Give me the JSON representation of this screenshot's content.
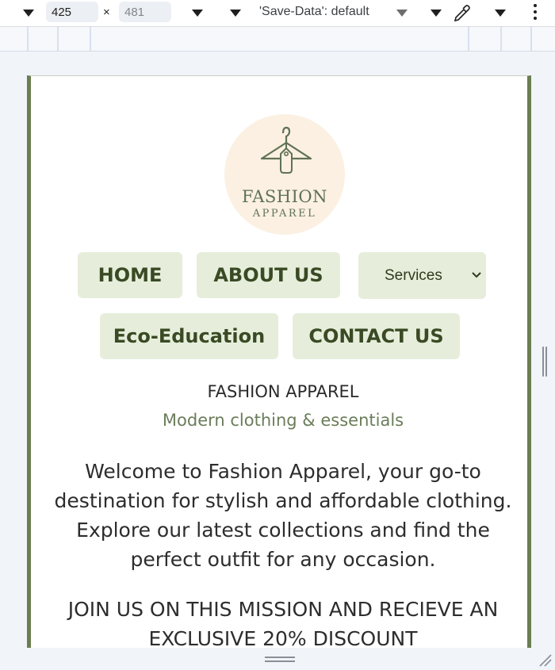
{
  "devtools": {
    "width_value": "425",
    "height_placeholder": "481",
    "times_sign": "×",
    "save_data_label": "'Save-Data': default"
  },
  "site": {
    "logo": {
      "title": "FASHION",
      "subtitle": "APPAREL",
      "icon": "hanger-icon"
    },
    "nav": {
      "home": "HOME",
      "about": "ABOUT US",
      "services_selected": "Services",
      "eco": "Eco-Education",
      "contact": "CONTACT US"
    },
    "title": "FASHION APPAREL",
    "tagline": "Modern clothing & essentials",
    "welcome": "Welcome to Fashion Apparel, your go-to destination for stylish and affordable clothing. Explore our latest collections and find the perfect outfit for any occasion.",
    "join": "JOIN US ON THIS MISSION AND RECIEVE AN EXCLUSIVE 20% DISCOUNT"
  },
  "colors": {
    "accent": "#6b7d51",
    "nav_bg": "#e6eedb",
    "logo_bg": "#fbf0e2"
  }
}
